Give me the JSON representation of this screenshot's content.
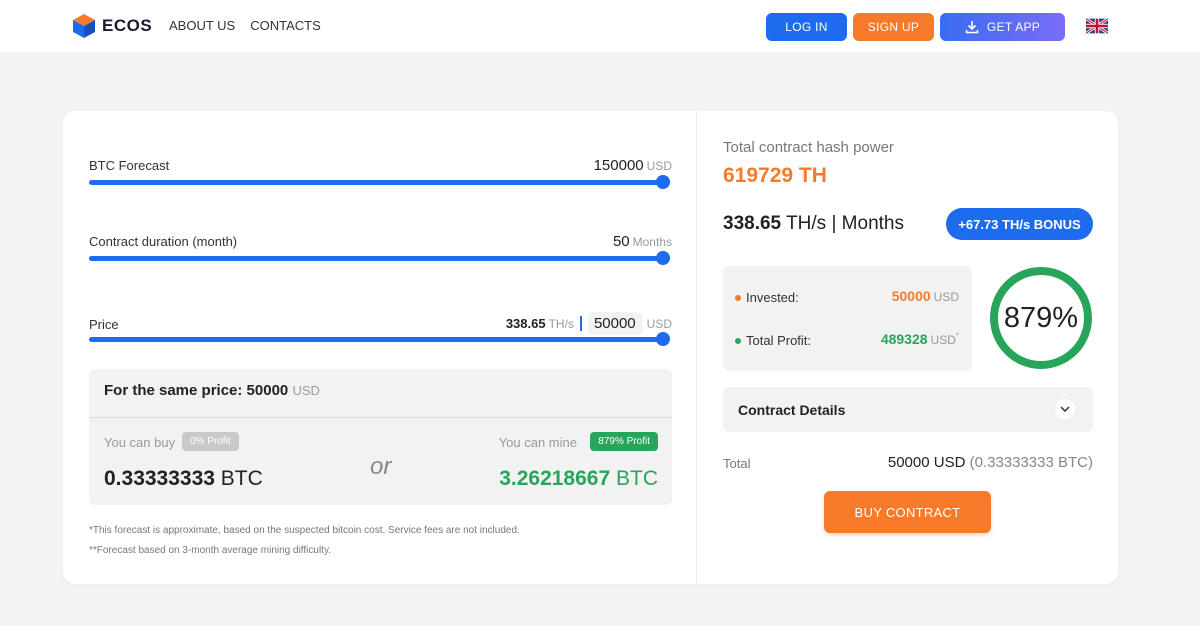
{
  "header": {
    "brand": "ECOS",
    "nav": [
      "ABOUT US",
      "CONTACTS"
    ],
    "login": "LOG IN",
    "signup": "SIGN UP",
    "getapp": "GET APP"
  },
  "calculator": {
    "btc_forecast": {
      "label": "BTC Forecast",
      "value": "150000",
      "unit": "USD",
      "level": 1.0
    },
    "duration": {
      "label": "Contract duration (month)",
      "value": "50",
      "unit": "Months",
      "level": 1.0
    },
    "price": {
      "label": "Price",
      "ths": "338.65",
      "ths_unit": "TH/s",
      "value": "50000",
      "unit": "USD",
      "level": 1.0
    },
    "compare": {
      "heading": "For the same price: 50000",
      "heading_unit": "USD",
      "buy_label": "You can buy",
      "buy_badge": "0% Profit",
      "buy_value": "0.33333333",
      "buy_unit": "BTC",
      "or": "or",
      "mine_label": "You can mine",
      "mine_badge": "879% Profit",
      "mine_value": "3.26218667",
      "mine_unit": "BTC"
    },
    "notes": [
      "*This forecast is approximate, based on the suspected bitcoin cost. Service fees are not included.",
      "**Forecast based on 3-month average mining difficulty."
    ]
  },
  "summary": {
    "title": "Total contract hash power",
    "hash": "619729 TH",
    "ths_value": "338.65",
    "ths_unit": "TH/s",
    "sep": "|",
    "months": "Months",
    "bonus": "+67.73 TH/s BONUS",
    "invested_label": "Invested:",
    "invested_value": "50000",
    "invested_unit": "USD",
    "profit_label": "Total Profit:",
    "profit_value": "489328",
    "profit_unit": "USD",
    "profit_mark": "*",
    "percent": "879%",
    "details": "Contract Details",
    "total_label": "Total",
    "total_value": "50000 USD",
    "total_btc": "(0.33333333 BTC)",
    "buy": "BUY CONTRACT"
  },
  "colors": {
    "accent_blue": "#1d6cf0",
    "accent_orange": "#f77a2a",
    "profit_green": "#27a55a"
  }
}
